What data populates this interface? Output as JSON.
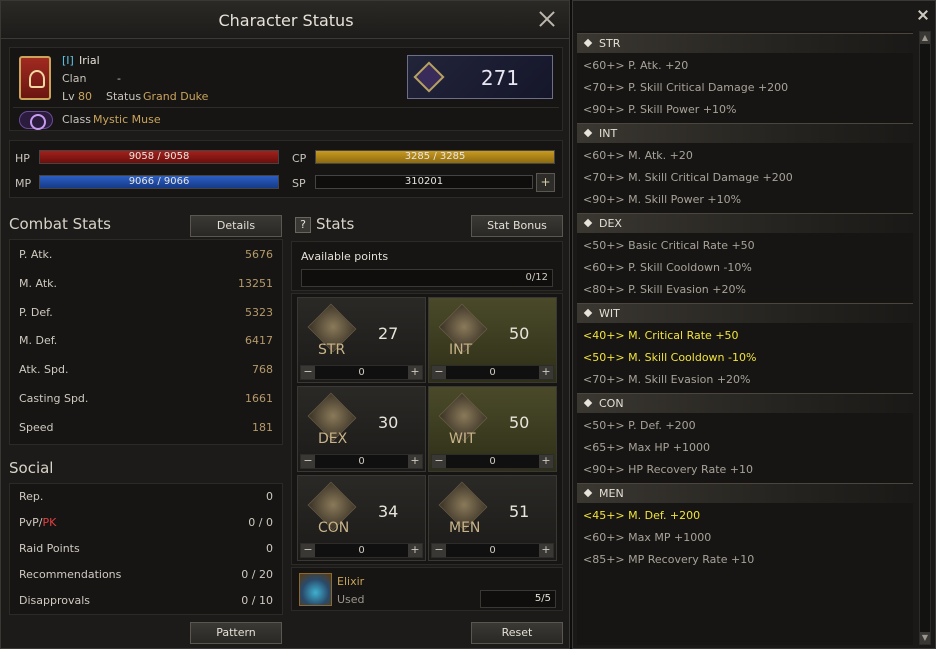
{
  "window": {
    "title": "Character Status"
  },
  "character": {
    "tag": "[I]",
    "name": "Irial",
    "clan_label": "Clan",
    "clan_value": "-",
    "lv_label": "Lv",
    "level": "80",
    "status_label": "Status",
    "status_value": "Grand Duke",
    "class_label": "Class",
    "class_value": "Mystic Muse",
    "combat_power": "271"
  },
  "vitals": {
    "hp_label": "HP",
    "hp": "9058 / 9058",
    "hp_fraction": 1.0,
    "mp_label": "MP",
    "mp": "9066 / 9066",
    "mp_fraction": 1.0,
    "cp_label": "CP",
    "cp": "3285 / 3285",
    "cp_fraction": 1.0,
    "sp_label": "SP",
    "sp": "310201"
  },
  "combat": {
    "title": "Combat Stats",
    "details_label": "Details",
    "rows": [
      {
        "k": "P. Atk.",
        "v": "5676"
      },
      {
        "k": "M. Atk.",
        "v": "13251"
      },
      {
        "k": "P. Def.",
        "v": "5323"
      },
      {
        "k": "M. Def.",
        "v": "6417"
      },
      {
        "k": "Atk. Spd.",
        "v": "768"
      },
      {
        "k": "Casting Spd.",
        "v": "1661"
      },
      {
        "k": "Speed",
        "v": "181"
      }
    ]
  },
  "social": {
    "title": "Social",
    "rows": [
      {
        "k": "Rep.",
        "v": "0"
      },
      {
        "k": "PvP/",
        "k2": "PK",
        "v": "0 / 0"
      },
      {
        "k": "Raid Points",
        "v": "0"
      },
      {
        "k": "Recommendations",
        "v": "0 / 20"
      },
      {
        "k": "Disapprovals",
        "v": "0 / 10"
      }
    ],
    "pattern_label": "Pattern"
  },
  "stats": {
    "help_glyph": "?",
    "title": "Stats",
    "stat_bonus_label": "Stat Bonus",
    "available_label": "Available points",
    "available_value": "0/12",
    "grid": [
      {
        "name": "STR",
        "value": "27",
        "add": "0"
      },
      {
        "name": "INT",
        "value": "50",
        "add": "0"
      },
      {
        "name": "DEX",
        "value": "30",
        "add": "0"
      },
      {
        "name": "WIT",
        "value": "50",
        "add": "0"
      },
      {
        "name": "CON",
        "value": "34",
        "add": "0"
      },
      {
        "name": "MEN",
        "value": "51",
        "add": "0"
      }
    ],
    "elixir_label": "Elixir",
    "used_label": "Used",
    "used_value": "5/5",
    "reset_label": "Reset"
  },
  "bonus": {
    "groups": [
      {
        "name": "STR",
        "items": [
          {
            "text": "<60+> P. Atk. +20",
            "active": false
          },
          {
            "text": "<70+> P. Skill Critical Damage +200",
            "active": false
          },
          {
            "text": "<90+> P. Skill Power +10%",
            "active": false
          }
        ]
      },
      {
        "name": "INT",
        "items": [
          {
            "text": "<60+> M. Atk. +20",
            "active": false
          },
          {
            "text": "<70+> M. Skill Critical Damage +200",
            "active": false
          },
          {
            "text": "<90+> M. Skill Power +10%",
            "active": false
          }
        ]
      },
      {
        "name": "DEX",
        "items": [
          {
            "text": "<50+> Basic Critical Rate +50",
            "active": false
          },
          {
            "text": "<60+> P. Skill Cooldown -10%",
            "active": false
          },
          {
            "text": "<80+> P. Skill Evasion +20%",
            "active": false
          }
        ]
      },
      {
        "name": "WIT",
        "items": [
          {
            "text": "<40+> M. Critical Rate +50",
            "active": true
          },
          {
            "text": "<50+> M. Skill Cooldown -10%",
            "active": true
          },
          {
            "text": "<70+> M. Skill Evasion +20%",
            "active": false
          }
        ]
      },
      {
        "name": "CON",
        "items": [
          {
            "text": "<50+> P. Def. +200",
            "active": false
          },
          {
            "text": "<65+> Max HP +1000",
            "active": false
          },
          {
            "text": "<90+> HP Recovery Rate +10",
            "active": false
          }
        ]
      },
      {
        "name": "MEN",
        "items": [
          {
            "text": "<45+> M. Def. +200",
            "active": true
          },
          {
            "text": "<60+> Max MP +1000",
            "active": false
          },
          {
            "text": "<85+> MP Recovery Rate +10",
            "active": false
          }
        ]
      }
    ]
  }
}
